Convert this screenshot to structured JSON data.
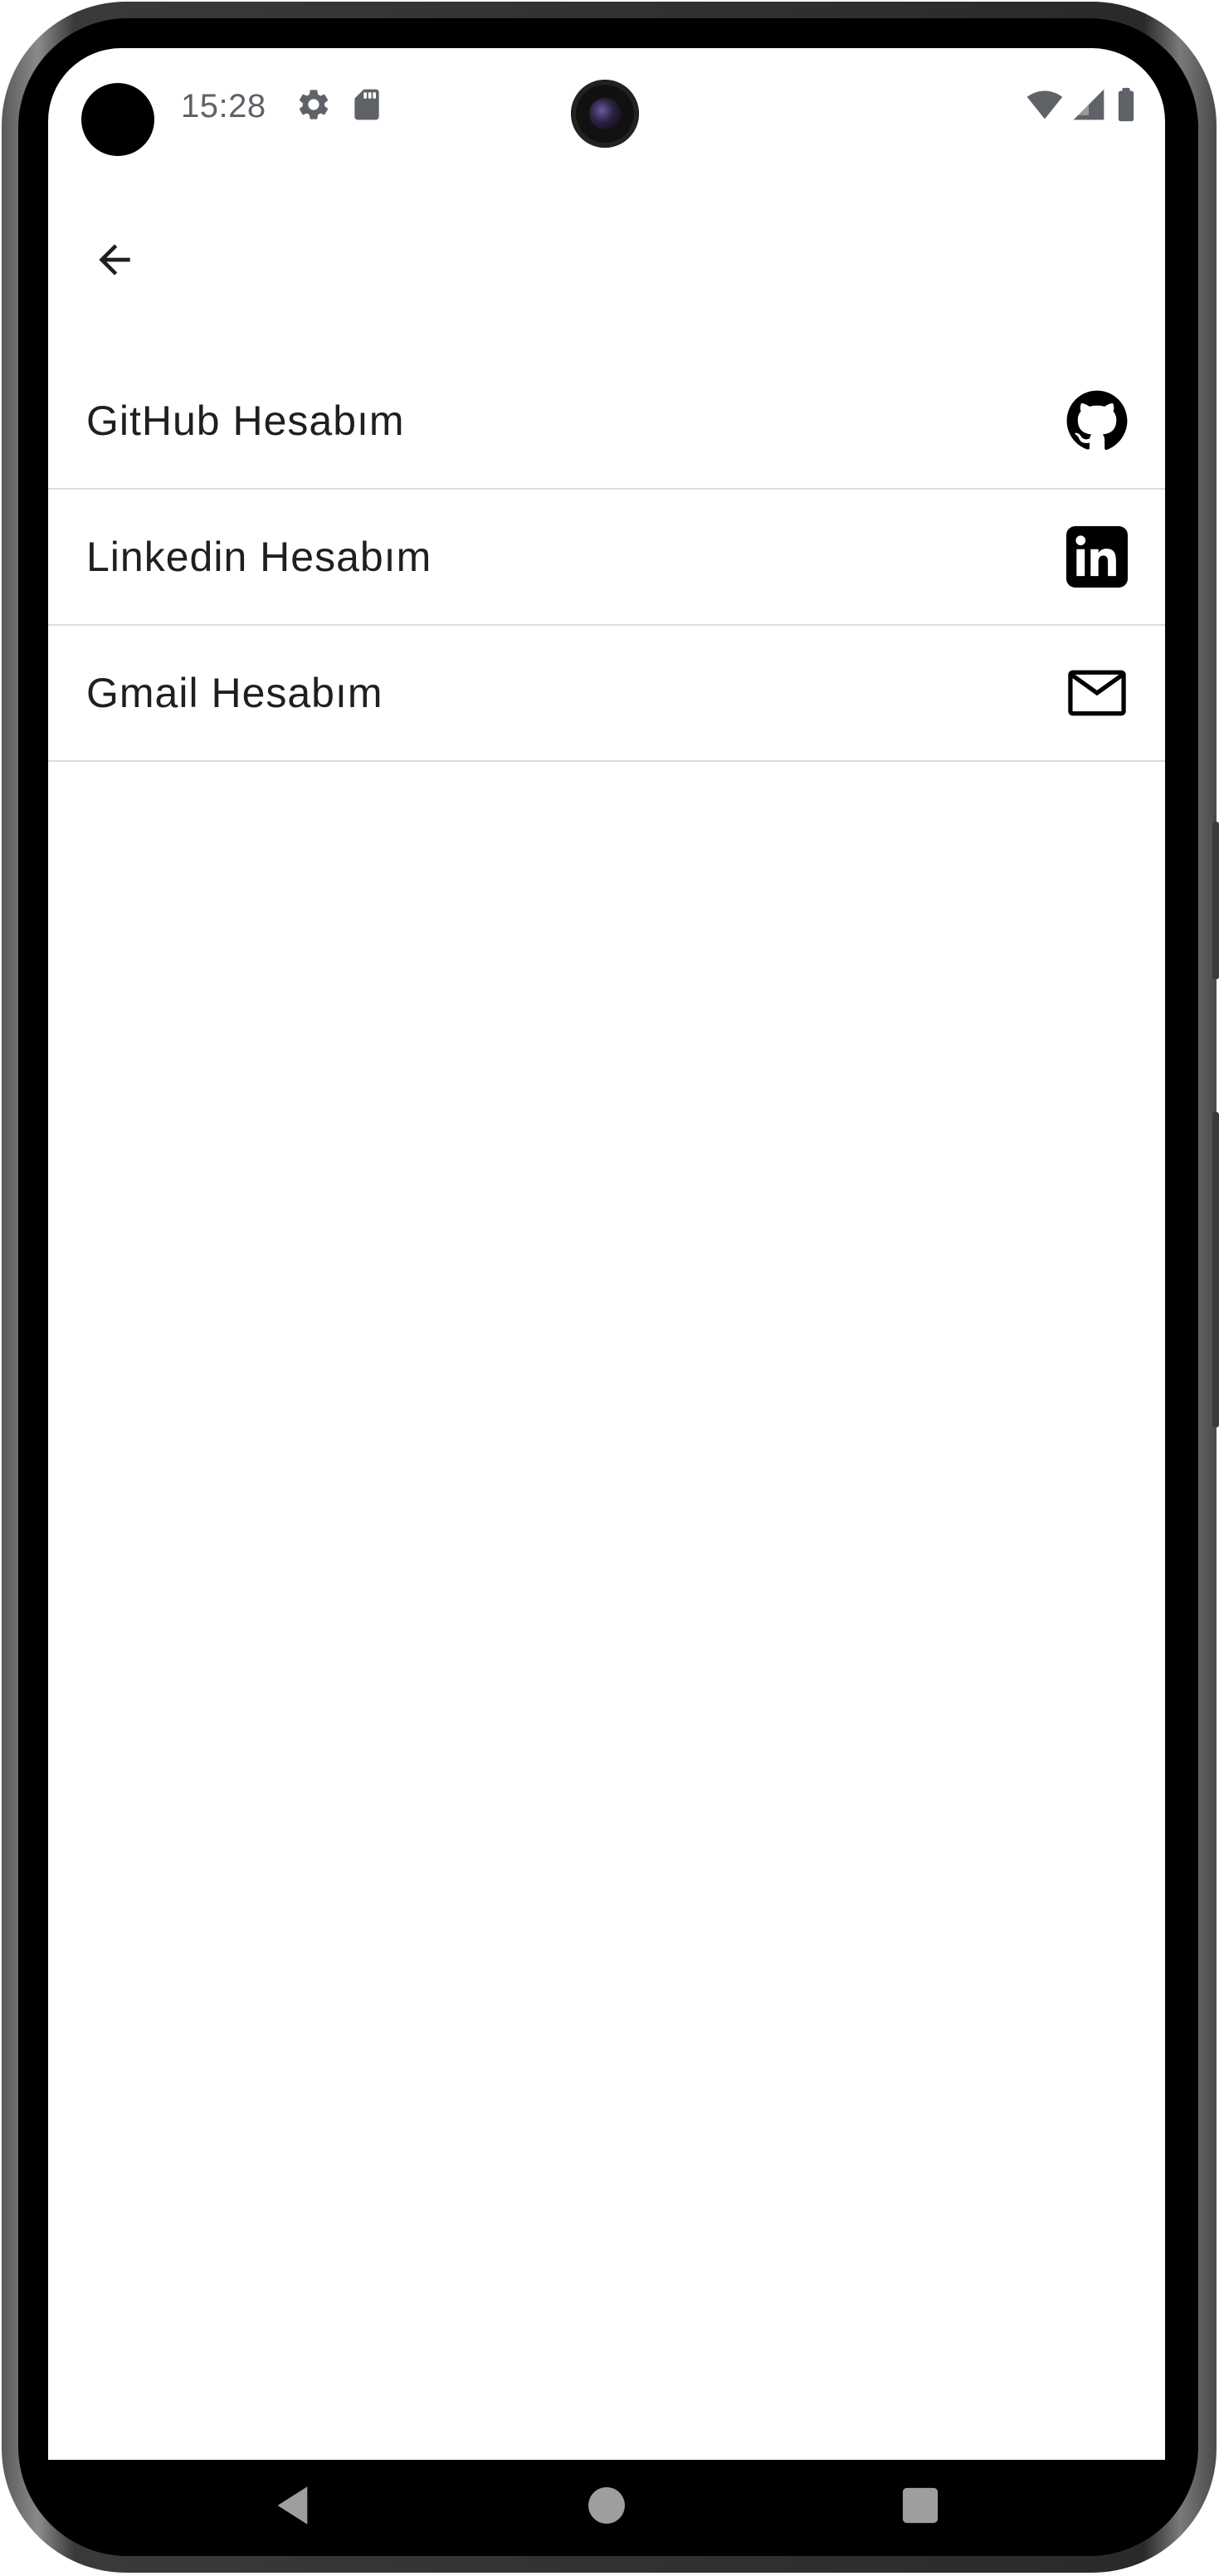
{
  "status_bar": {
    "time": "15:28",
    "icons": [
      "settings-icon",
      "sd-card-icon",
      "wifi-icon",
      "signal-icon",
      "battery-icon"
    ]
  },
  "app_bar": {
    "back_icon": "arrow-back-icon"
  },
  "accounts": {
    "items": [
      {
        "label": "GitHub Hesabım",
        "icon": "github-icon"
      },
      {
        "label": "Linkedin Hesabım",
        "icon": "linkedin-icon"
      },
      {
        "label": "Gmail Hesabım",
        "icon": "mail-icon"
      }
    ]
  },
  "nav_bar": {
    "buttons": [
      "back-triangle-icon",
      "home-circle-icon",
      "recents-square-icon"
    ]
  },
  "colors": {
    "text": "#1f1f1f",
    "divider": "#dcdcdc",
    "status_text": "#5f6368",
    "nav_icons": "#9e9e9e"
  }
}
